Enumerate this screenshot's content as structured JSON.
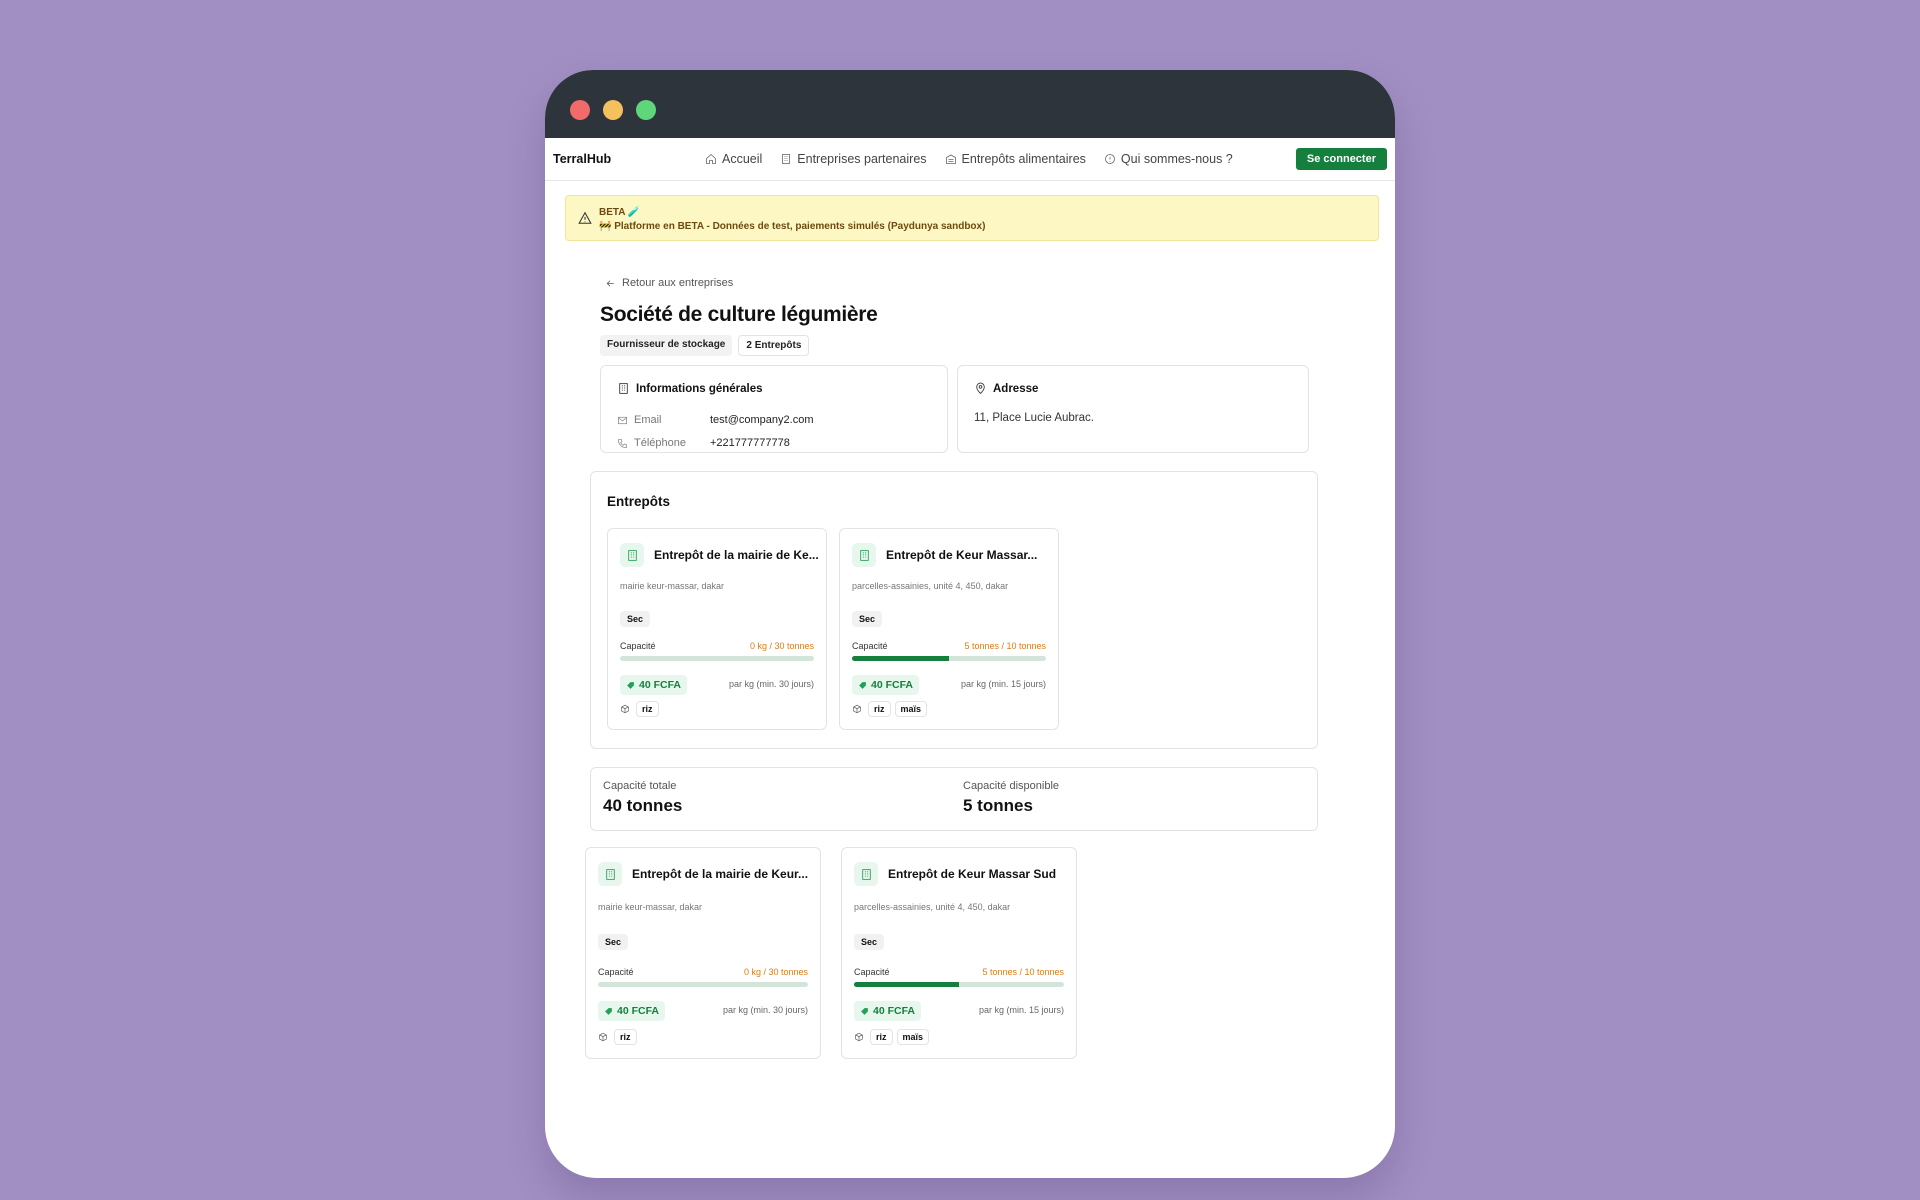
{
  "navbar": {
    "brand": "TerralHub",
    "links": [
      {
        "label": "Accueil",
        "icon": "home-icon"
      },
      {
        "label": "Entreprises partenaires",
        "icon": "building-icon"
      },
      {
        "label": "Entrepôts alimentaires",
        "icon": "warehouse-icon"
      },
      {
        "label": "Qui sommes-nous ?",
        "icon": "info-icon"
      }
    ],
    "login_label": "Se connecter"
  },
  "beta": {
    "title": "BETA 🧪",
    "text": "🚧 Platforme en BETA - Données de test, paiements simulés (Paydunya sandbox)"
  },
  "page": {
    "back_label": "Retour aux entreprises",
    "title": "Société de culture légumière",
    "tags": [
      "Fournisseur de stockage",
      "2 Entrepôts"
    ]
  },
  "info": {
    "title": "Informations générales",
    "email_label": "Email",
    "email": "test@company2.com",
    "phone_label": "Téléphone",
    "phone": "+221777777778"
  },
  "address": {
    "title": "Adresse",
    "text": "11, Place Lucie Aubrac."
  },
  "warehouses_section": {
    "title": "Entrepôts",
    "cards": [
      {
        "name": "Entrepôt de la mairie de Ke...",
        "address": "mairie keur-massar, dakar",
        "type": "Sec",
        "capacity_label": "Capacité",
        "capacity": "0 kg / 30 tonnes",
        "fill_percent": 0,
        "price": "40 FCFA",
        "price_note": "par kg (min. 30 jours)",
        "crops": [
          "riz"
        ]
      },
      {
        "name": "Entrepôt de Keur Massar...",
        "address": "parcelles-assainies, unité 4, 450, dakar",
        "type": "Sec",
        "capacity_label": "Capacité",
        "capacity": "5 tonnes / 10 tonnes",
        "fill_percent": 50,
        "price": "40 FCFA",
        "price_note": "par kg (min. 15 jours)",
        "crops": [
          "riz",
          "maïs"
        ]
      }
    ]
  },
  "stats": {
    "total_label": "Capacité totale",
    "total": "40 tonnes",
    "available_label": "Capacité disponible",
    "available": "5 tonnes"
  },
  "bottom_cards": [
    {
      "name": "Entrepôt de la mairie de Keur...",
      "address": "mairie keur-massar, dakar",
      "type": "Sec",
      "capacity_label": "Capacité",
      "capacity": "0 kg / 30 tonnes",
      "fill_percent": 0,
      "price": "40 FCFA",
      "price_note": "par kg (min. 30 jours)",
      "crops": [
        "riz"
      ]
    },
    {
      "name": "Entrepôt de Keur Massar Sud",
      "address": "parcelles-assainies, unité 4, 450, dakar",
      "type": "Sec",
      "capacity_label": "Capacité",
      "capacity": "5 tonnes / 10 tonnes",
      "fill_percent": 50,
      "price": "40 FCFA",
      "price_note": "par kg (min. 15 jours)",
      "crops": [
        "riz",
        "maïs"
      ]
    }
  ],
  "colors": {
    "background": "#a18fc3",
    "titlebar": "#2e343b",
    "accent_green": "#15803d",
    "capacity_orange": "#e07b11",
    "beta_bg": "#fdf7c3"
  }
}
